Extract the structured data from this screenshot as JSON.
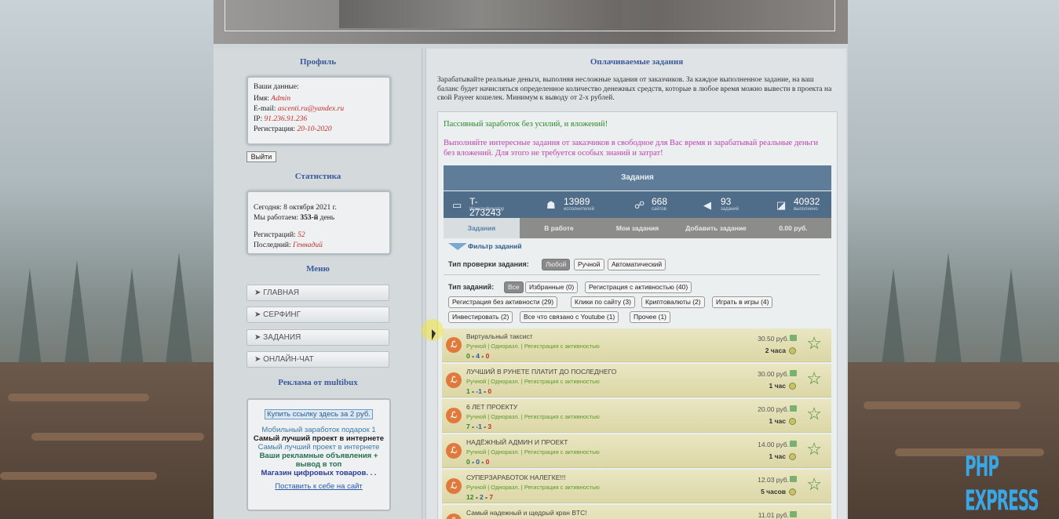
{
  "profile": {
    "title": "Профиль",
    "heading": "Ваши данные:",
    "name_label": "Имя:",
    "name_value": "Admin",
    "email_label": "E-mail:",
    "email_value": "ascenti.ru@yandex.ru",
    "ip_label": "IP:",
    "ip_value": "91.236.91.236",
    "reg_label": "Регистрация:",
    "reg_value": "20-10-2020",
    "logout": "Выйти"
  },
  "stats": {
    "title": "Статистика",
    "today": "Сегодня: 8 октября 2021 г.",
    "working_label": "Мы работаем:",
    "working_value": "353-й",
    "working_suffix": "день",
    "regs_label": "Регистраций:",
    "regs_value": "52",
    "last_label": "Последний:",
    "last_value": "Геннадий"
  },
  "menu": {
    "title": "Меню",
    "items": [
      "➤ ГЛАВНАЯ",
      "➤ СЕРФИНГ",
      "➤ ЗАДАНИЯ",
      "➤ ОНЛАЙН-ЧАТ"
    ]
  },
  "ads": {
    "title": "Реклама от multibux",
    "buy": "Купить ссылку здесь за 2 руб.",
    "l1": "Мобильный заработок подарок 1",
    "l2": "Самый лучший проект в интернете",
    "l3": "Самый лучший проект в интернете",
    "l4": "Ваши рекламные объявления + вывод в топ",
    "l5": "Магазин цифровых товаров. . .",
    "link": "Поставить к себе на сайт"
  },
  "main": {
    "title": "Оплачиваемые задания",
    "intro": "Зарабатывайте реальные деньги, выполняя несложные задания от заказчиков. За каждое выполненное задание, на ваш баланс будет начисляться определенное количество денежных средств, которые в любое время можно вывести в проекта на свой Payeer кошелек. Минимум к выводу от 2-х рублей.",
    "green": "Пассивный заработок без усилий, и вложений!",
    "pink": "Выполняйте интересные задания от заказчиков в свободное для Вас время и зарабатывай реальные деньги без вложений. Для этого не требуется особых знаний и затрат!"
  },
  "tasks_widget": {
    "header": "Задания",
    "stats": [
      {
        "icon": "id-card-icon",
        "glyph": "▭",
        "num": "T-273243",
        "label": "Идентификатор"
      },
      {
        "icon": "users-icon",
        "glyph": "☗",
        "num": "13989",
        "label": "исполнителей"
      },
      {
        "icon": "sitemap-icon",
        "glyph": "☍",
        "num": "668",
        "label": "сайтов"
      },
      {
        "icon": "megaphone-icon",
        "glyph": "◀",
        "num": "93",
        "label": "заданий"
      },
      {
        "icon": "chart-icon",
        "glyph": "◪",
        "num": "40932",
        "label": "выполнено"
      }
    ],
    "tabs": [
      "Задания",
      "В работе",
      "Мои задания",
      "Добавить задание",
      "0.00 руб."
    ],
    "filter_title": "Фильтр заданий",
    "check_label": "Тип проверки задания:",
    "check_options": [
      "Любой",
      "Ручной",
      "Автоматический"
    ],
    "type_label": "Тип заданий:",
    "types": [
      "Все",
      "Избранные (0)",
      "Регистрация с активностью (40)",
      "Регистрация без активности (29)",
      "Клики по сайту (3)",
      "Криптовалюты (2)",
      "Играть в игры (4)",
      "Инвестировать (2)",
      "Все что связано с Youtube (1)",
      "Прочее (1)"
    ]
  },
  "task_list": [
    {
      "title": "Виртуальный таксист",
      "meta": "Ручной | Одноразл. | Регистрация с активностью",
      "n1": "0",
      "n2": "4",
      "n3": "0",
      "price": "30.50 руб.",
      "time": "2 часа"
    },
    {
      "title": "ЛУЧШИЙ В РУНЕТЕ ПЛАТИТ ДО ПОСЛЕДНЕГО",
      "meta": "Ручной | Одноразл. | Регистрация с активностью",
      "n1": "1",
      "n2": "-1",
      "n3": "0",
      "price": "30.00 руб.",
      "time": "1 час"
    },
    {
      "title": "6 ЛЕТ ПРОЕКТУ",
      "meta": "Ручной | Одноразл. | Регистрация с активностью",
      "n1": "7",
      "n2": "-1",
      "n3": "3",
      "price": "20.00 руб.",
      "time": "1 час"
    },
    {
      "title": "НАДЁЖНЫЙ АДМИН И ПРОЕКТ",
      "meta": "Ручной | Одноразл. | Регистрация с активностью",
      "n1": "0",
      "n2": "0",
      "n3": "0",
      "price": "14.00 руб.",
      "time": "1 час"
    },
    {
      "title": "СУПЕРЗАРАБОТОК НАЛЕГКЕ!!!",
      "meta": "Ручной | Одноразл. | Регистрация с активностью",
      "n1": "12",
      "n2": "2",
      "n3": "7",
      "price": "12.03 руб.",
      "time": "5 часов"
    },
    {
      "title": "Самый надежный и щедрый кран BTC!",
      "meta": "",
      "n1": "",
      "n2": "",
      "n3": "",
      "price": "11.01 руб.",
      "time": ""
    }
  ],
  "watermark": "PHP EXPRESS"
}
